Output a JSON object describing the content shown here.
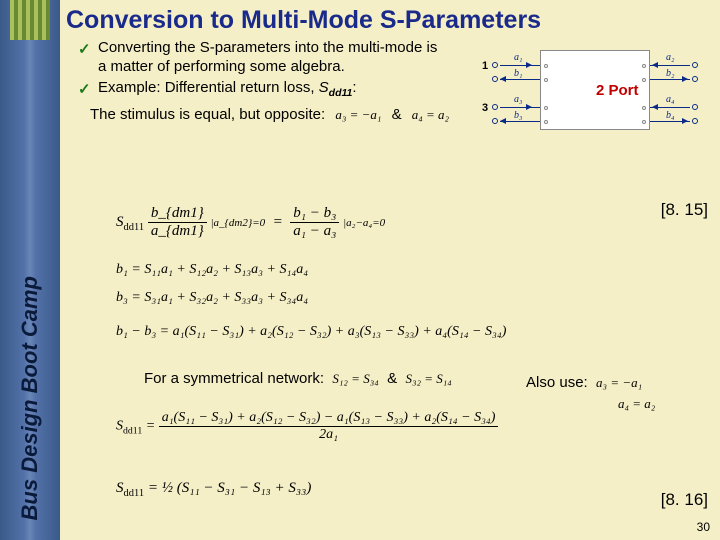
{
  "sidebar": {
    "vertical_title": "Bus Design Boot Camp"
  },
  "title": "Conversion to Multi-Mode S-Parameters",
  "bullets": {
    "b1": "Converting the S-parameters into the multi-mode is a matter of performing some algebra.",
    "b2_prefix": "Example: Differential return loss, ",
    "b2_sym": "S",
    "b2_sub": "dd11",
    "b2_suffix": ":"
  },
  "stimulus": {
    "text": "The stimulus is equal, but opposite:",
    "eq_left": "a₃ = −a₁",
    "amp": "&",
    "eq_right": "a₄ = a₂"
  },
  "eqref": {
    "a": "[8. 15]",
    "b": "[8. 16]"
  },
  "sym_network": {
    "text": "For a symmetrical network:",
    "e1": "S₁₂ = S₃₄",
    "amp": "&",
    "e2": "S₃₂ = S₁₄",
    "also": "Also use:",
    "u1": "a₃ = −a₁",
    "u2": "a₄ = a₂"
  },
  "diagram": {
    "label": "2 Port",
    "portnums": {
      "p1": "1",
      "p3": "3"
    },
    "sigs": {
      "la1": "a₁",
      "lb1": "b₁",
      "la3": "a₃",
      "lb3": "b₃",
      "ra2": "a₂",
      "rb2": "b₂",
      "ra4": "a₄",
      "rb4": "b₄"
    }
  },
  "equations": {
    "sdd11_def_lhs": "S",
    "sdd11_def_sub": "dd11",
    "sdd11_frac_num": "b_{dm1}",
    "sdd11_frac_den": "a_{dm1}",
    "sdd11_cond": "|a_{dm2}=0",
    "sdd11_rhs_num": "b₁ − b₃",
    "sdd11_rhs_den": "a₁ − a₃",
    "sdd11_rhs_cond": "|a₂−a₄=0",
    "b1_row": "b₁ = S₁₁a₁ + S₁₂a₂ + S₁₃a₃ + S₁₄a₄",
    "b3_row": "b₃ = S₃₁a₁ + S₃₂a₂ + S₃₃a₃ + S₃₄a₄",
    "diff_row": "b₁ − b₃ = a₁(S₁₁ − S₃₁) + a₂(S₁₂ − S₃₂) + a₃(S₁₃ − S₃₃) + a₄(S₁₄ − S₃₄)",
    "sdd11_long_num": "a₁(S₁₁ − S₃₁) + a₂(S₁₂ − S₃₂) − a₁(S₁₃ − S₃₃) + a₂(S₁₄ − S₃₄)",
    "sdd11_long_den": "2a₁",
    "final_lhs": "S_{dd11}",
    "final_rhs": "= ½ (S₁₁ − S₃₁ − S₁₃ + S₃₃)"
  },
  "page_number": "30"
}
